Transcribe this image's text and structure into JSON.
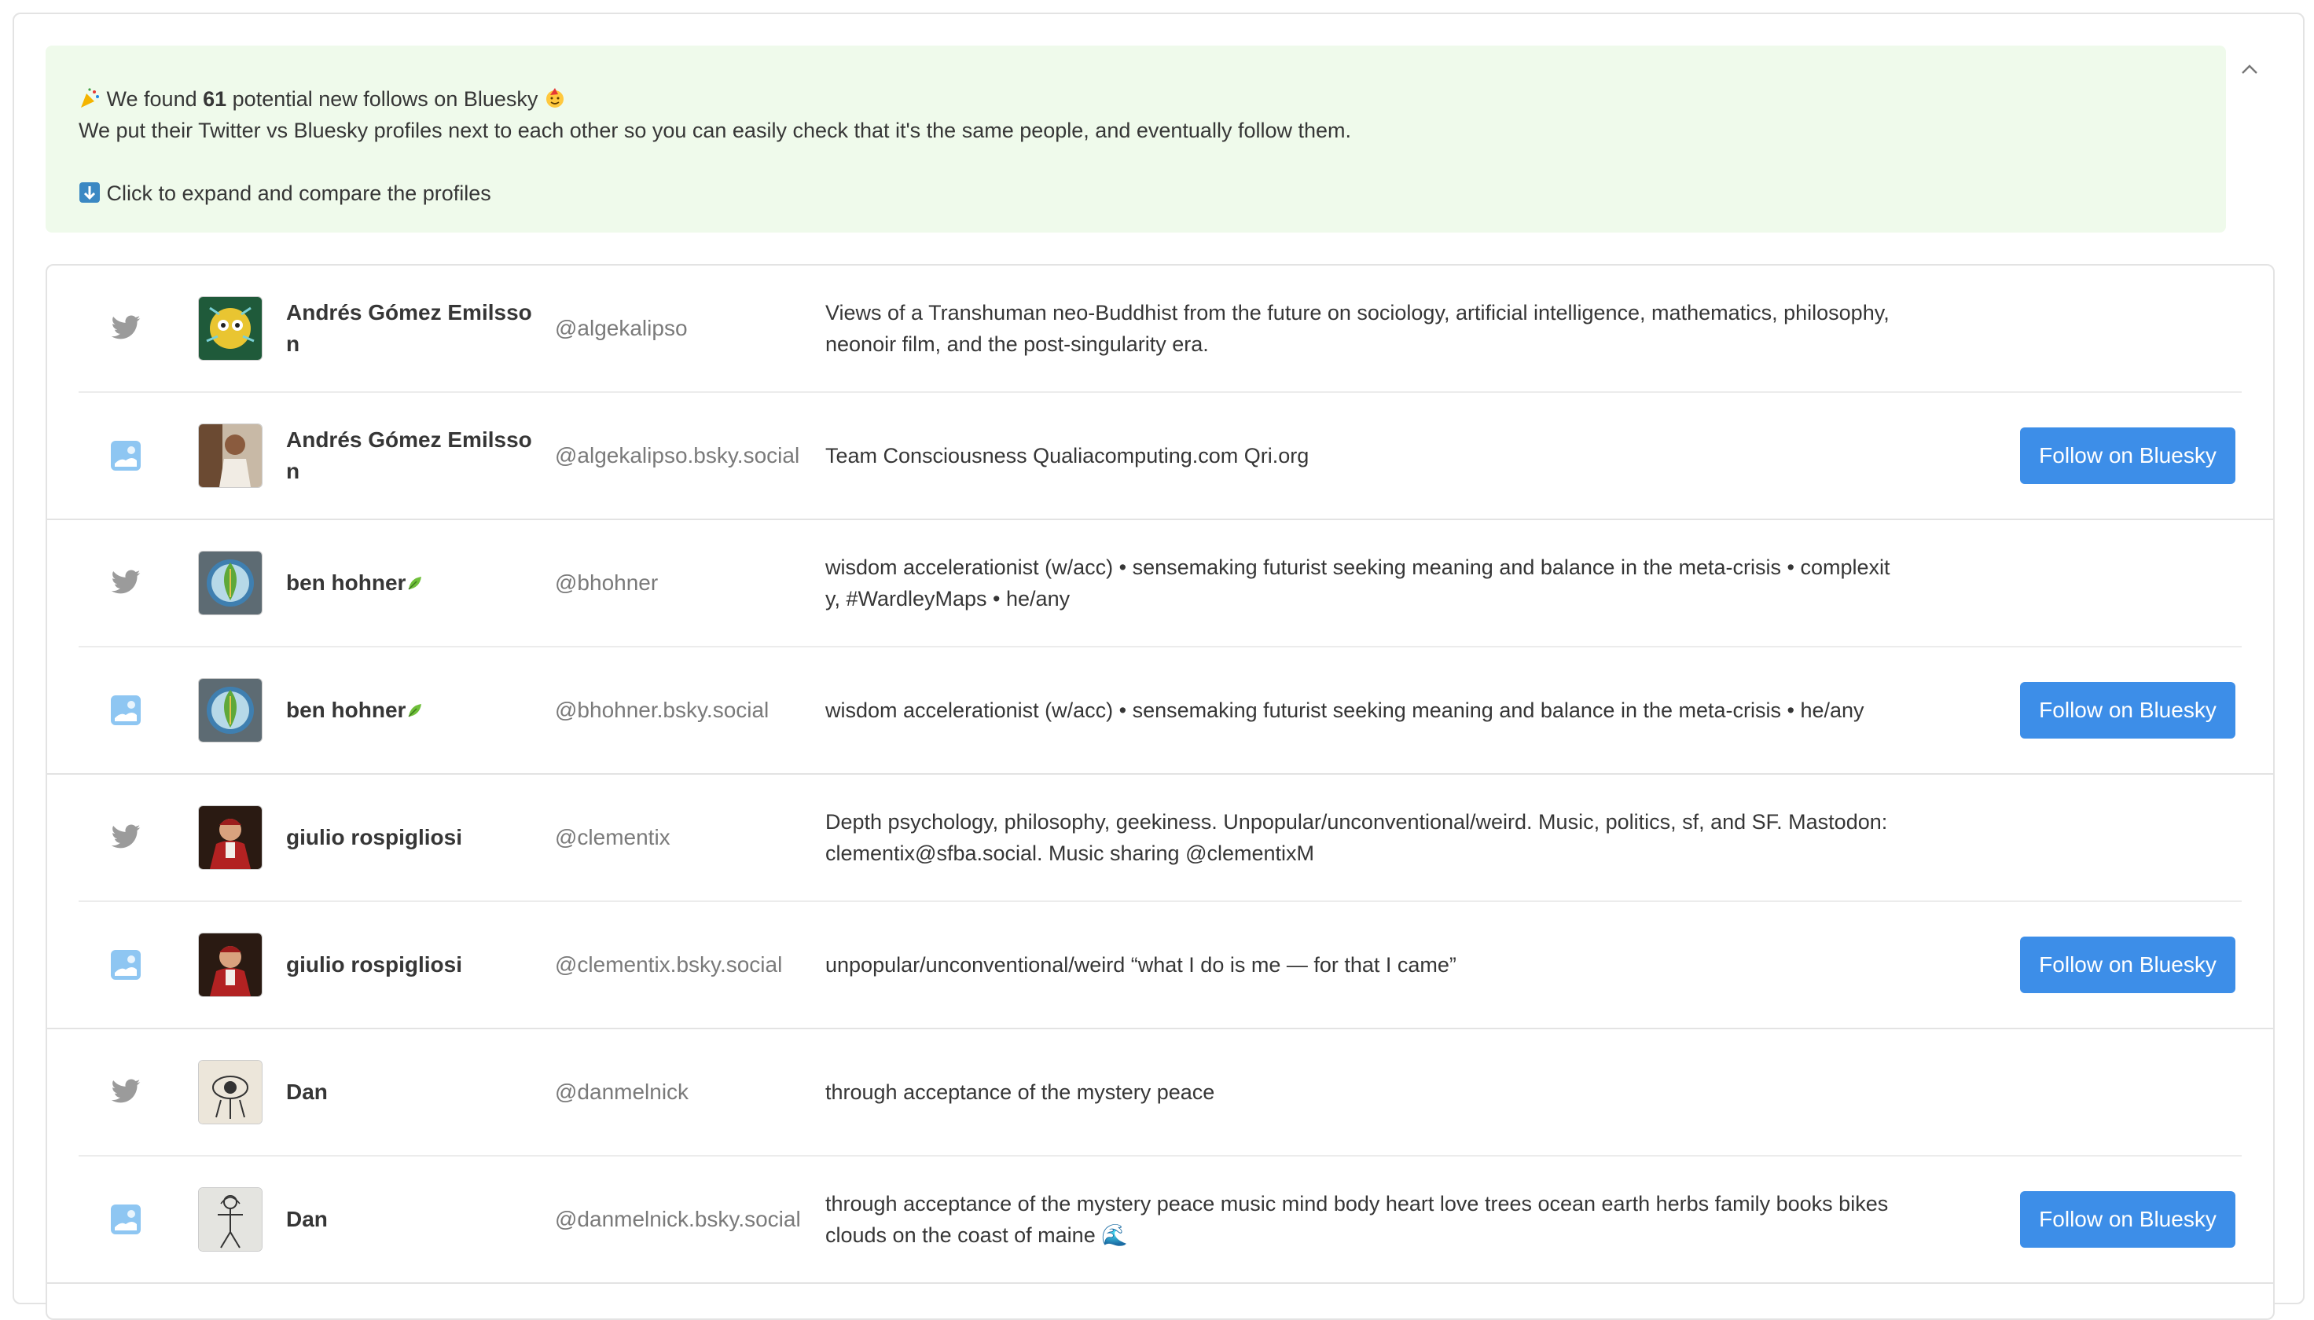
{
  "banner": {
    "line1_pre": "We found ",
    "count": "61",
    "line1_post": " potential new follows on Bluesky",
    "line2": "We put their Twitter vs Bluesky profiles next to each other so you can easily check that it's the same people, and eventually follow them.",
    "line3": "Click to expand and compare the profiles",
    "icons": [
      "party-popper-icon",
      "party-face-icon",
      "down-arrow-icon"
    ]
  },
  "follow_label": "Follow on Bluesky",
  "colors": {
    "banner_bg": "#effaeb",
    "button": "#3d8ee8",
    "twitter_icon": "#9b9b9b"
  },
  "pairs": [
    {
      "twitter": {
        "name": "Andrés Gómez Emilsson",
        "handle": "@algekalipso",
        "bio": "Views of a Transhuman neo-Buddhist from the future on sociology, artificial intelligence, mathematics, philosophy, neonoir film, and the post-singularity era."
      },
      "bluesky": {
        "name": "Andrés Gómez Emilsson",
        "handle": "@algekalipso.bsky.social",
        "bio": "Team Consciousness Qualiacomputing.com Qri.org"
      }
    },
    {
      "twitter": {
        "name": "ben hohner",
        "handle": "@bhohner",
        "bio": "wisdom accelerationist (w/acc) • sensemaking futurist seeking meaning and balance in the meta-crisis • complexity, #WardleyMaps • he/any"
      },
      "bluesky": {
        "name": "ben hohner",
        "handle": "@bhohner.bsky.social",
        "bio": "wisdom accelerationist (w/acc) • sensemaking futurist seeking meaning and balance in the meta-crisis • he/any"
      }
    },
    {
      "twitter": {
        "name": "giulio rospigliosi",
        "handle": "@clementix",
        "bio": "Depth psychology, philosophy, geekiness. Unpopular/unconventional/weird. Music, politics, sf, and SF. Mastodon: clementix@sfba.social. Music sharing @clementixM"
      },
      "bluesky": {
        "name": "giulio rospigliosi",
        "handle": "@clementix.bsky.social",
        "bio": "unpopular/unconventional/weird “what I do is me — for that I came”"
      }
    },
    {
      "twitter": {
        "name": "Dan",
        "handle": "@danmelnick",
        "bio": "through acceptance of the mystery peace"
      },
      "bluesky": {
        "name": "Dan",
        "handle": "@danmelnick.bsky.social",
        "bio": "through acceptance of the mystery peace music mind body heart love trees ocean earth herbs family books bikes clouds on the coast of maine 🌊"
      }
    }
  ]
}
